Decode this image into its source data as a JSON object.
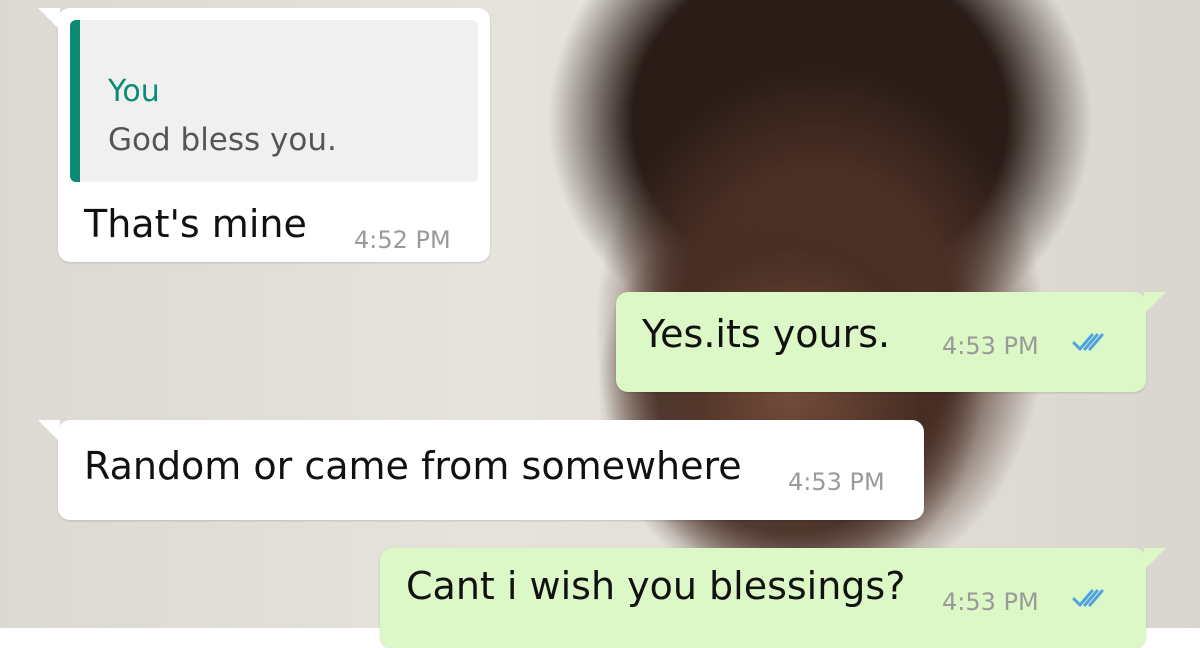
{
  "messages": [
    {
      "direction": "incoming",
      "quoted": {
        "author": "You",
        "text": "God bless you."
      },
      "text": "That's mine",
      "time": "4:52 PM"
    },
    {
      "direction": "outgoing",
      "text": "Yes.its yours.",
      "time": "4:53 PM",
      "status": "read"
    },
    {
      "direction": "incoming",
      "text": "Random or came from somewhere",
      "time": "4:53 PM"
    },
    {
      "direction": "outgoing",
      "text": "Cant i wish you blessings?",
      "time": "4:53 PM",
      "status": "read"
    }
  ],
  "colors": {
    "incoming_bubble": "#ffffff",
    "outgoing_bubble": "#dcf8c6",
    "quote_accent": "#0b8a76",
    "read_ticks": "#4fa3e0"
  },
  "icons": {
    "read_receipt": "double-check-icon"
  }
}
